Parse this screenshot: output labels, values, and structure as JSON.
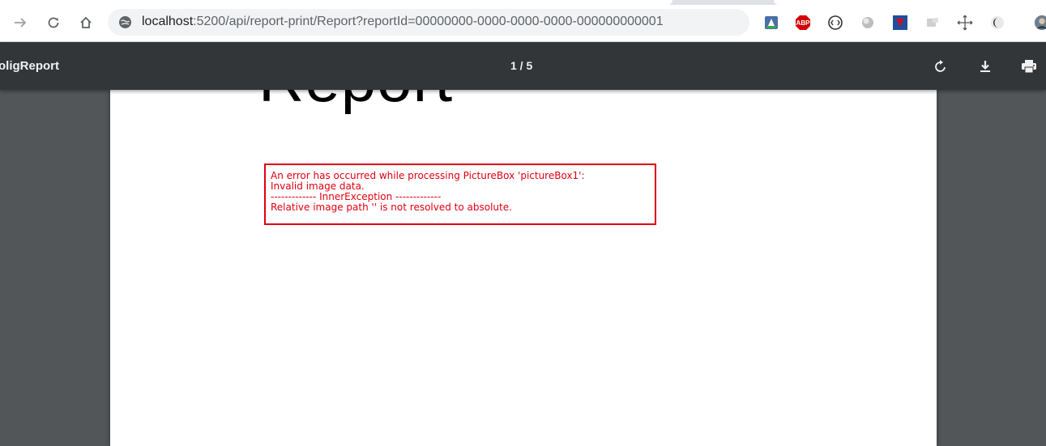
{
  "browser": {
    "url_host": "localhost",
    "url_rest": ":5200/api/report-print/Report?reportId=00000000-0000-0000-0000-000000000001",
    "nav": [
      "forward-icon",
      "reload-icon",
      "home-icon"
    ],
    "extensions": [
      "drive-extension-icon",
      "adblock-plus-icon",
      "extension-circle-icon",
      "extension-orb-icon",
      "mcafee-icon",
      "extension-gray-icon",
      "move-icon",
      "dark-mode-icon",
      "profile-avatar"
    ],
    "abp_label": "ABP"
  },
  "pdf_viewer": {
    "title": "oligReport",
    "page_indicator": "1 / 5",
    "actions": [
      "rotate-icon",
      "download-icon",
      "print-icon"
    ]
  },
  "document": {
    "heading": "Report",
    "error_lines": [
      "An error has occurred while processing PictureBox 'pictureBox1':",
      "Invalid image data.",
      "------------- InnerException -------------",
      "Relative image path '' is not resolved to absolute."
    ],
    "error_color": "#e0000f"
  }
}
